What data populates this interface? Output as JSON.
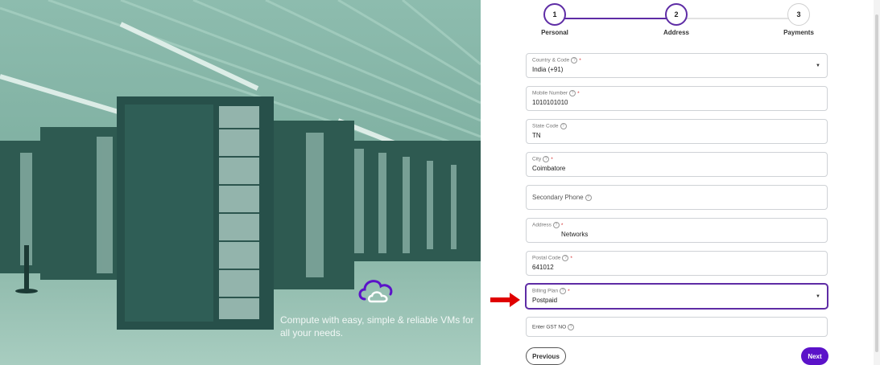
{
  "hero": {
    "tagline": "Compute with easy, simple & reliable VMs for all your needs.",
    "icon": "cloud-icon"
  },
  "stepper": {
    "steps": [
      {
        "number": "1",
        "label": "Personal",
        "state": "complete"
      },
      {
        "number": "2",
        "label": "Address",
        "state": "current"
      },
      {
        "number": "3",
        "label": "Payments",
        "state": "pending"
      }
    ]
  },
  "form": {
    "country": {
      "label": "Country & Code",
      "value": "India (+91)",
      "required": true
    },
    "mobile": {
      "label": "Mobile Number",
      "value": "1010101010",
      "required": true
    },
    "state_code": {
      "label": "State Code",
      "value": "TN",
      "required": false
    },
    "city": {
      "label": "City",
      "value": "Coimbatore",
      "required": true
    },
    "secondary_phone": {
      "placeholder": "Secondary Phone",
      "value": ""
    },
    "address": {
      "label": "Address",
      "value": "Networks",
      "required": true
    },
    "postal_code": {
      "label": "Postal Code",
      "value": "641012",
      "required": true
    },
    "billing_plan": {
      "label": "Billing Plan",
      "value": "Postpaid",
      "required": true
    },
    "gst": {
      "placeholder": "Enter GST NO",
      "value": ""
    }
  },
  "buttons": {
    "previous": "Previous",
    "next": "Next"
  },
  "colors": {
    "accent": "#5e2ca5",
    "next_button": "#5b12c9",
    "required_star": "#d32f2f",
    "pointer_arrow": "#e00000",
    "hero_tint": "#5f9386"
  },
  "symbols": {
    "help": "?",
    "required": "*",
    "caret": "▼"
  }
}
